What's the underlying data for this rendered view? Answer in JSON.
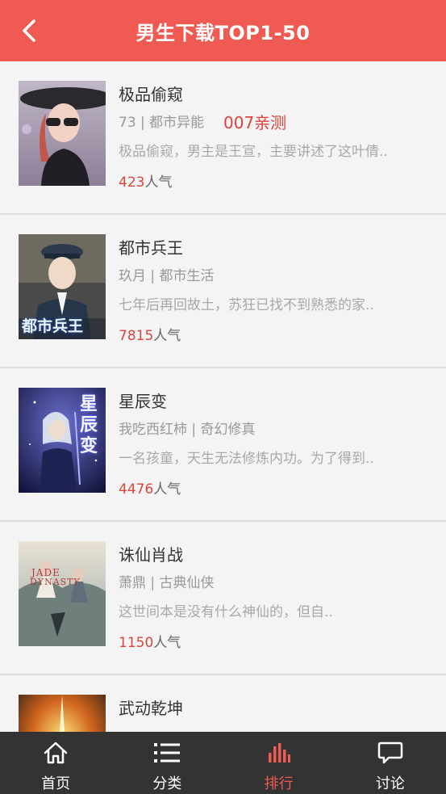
{
  "header": {
    "title": "男生下载TOP1-50",
    "back_icon": "chevron-left-icon"
  },
  "books": [
    {
      "title": "极品偷窥",
      "author": "73",
      "category": "都市异能",
      "meta": "73 | 都市异能",
      "tag": "007亲测",
      "desc": "极品偷窥，男主是王宣，主要讲述了这叶倩..",
      "popularity": "423",
      "pop_suffix": "人气"
    },
    {
      "title": "都市兵王",
      "author": "玖月",
      "category": "都市生活",
      "meta": "玖月 | 都市生活",
      "tag": "",
      "desc": "七年后再回故土，苏狂已找不到熟悉的家..",
      "popularity": "7815",
      "pop_suffix": "人气"
    },
    {
      "title": "星辰变",
      "author": "我吃西红柿",
      "category": "奇幻修真",
      "meta": "我吃西红柿 | 奇幻修真",
      "tag": "",
      "desc": "一名孩童，天生无法修炼内功。为了得到..",
      "popularity": "4476",
      "pop_suffix": "人气"
    },
    {
      "title": "诛仙肖战",
      "author": "萧鼎",
      "category": "古典仙侠",
      "meta": "萧鼎 | 古典仙侠",
      "tag": "",
      "desc": "这世间本是没有什么神仙的，但自..",
      "popularity": "1150",
      "pop_suffix": "人气"
    },
    {
      "title": "武动乾坤",
      "author": "",
      "category": "",
      "meta": "",
      "tag": "",
      "desc": "",
      "popularity": "",
      "pop_suffix": ""
    }
  ],
  "tabs": [
    {
      "label": "首页",
      "icon": "home-icon",
      "active": false
    },
    {
      "label": "分类",
      "icon": "list-icon",
      "active": false
    },
    {
      "label": "排行",
      "icon": "bar-chart-icon",
      "active": true
    },
    {
      "label": "讨论",
      "icon": "chat-bubble-icon",
      "active": false
    }
  ],
  "colors": {
    "accent": "#ef5a52",
    "tabbar_bg": "#333333",
    "popularity": "#d9463e"
  }
}
